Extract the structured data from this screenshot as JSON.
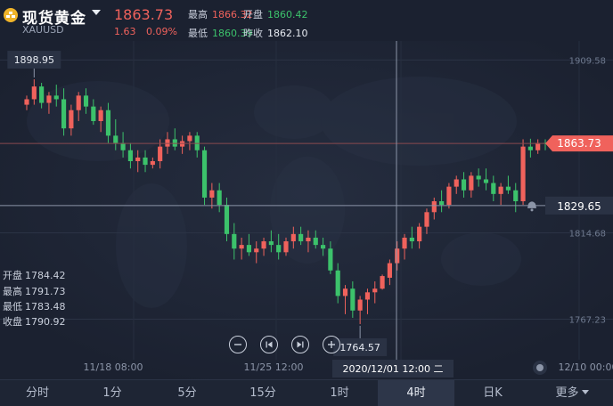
{
  "header": {
    "title": "现货黄金",
    "symbol": "XAUUSD",
    "price": "1863.73",
    "change": "1.63",
    "change_pct": "0.09%",
    "high_label": "最高",
    "high": "1866.32",
    "open_label": "开盘",
    "open": "1860.42",
    "low_label": "最低",
    "low": "1860.39",
    "prev_label": "昨收",
    "prev_close": "1862.10"
  },
  "chart": {
    "y_ticks": [
      "1909.58",
      "1814.68",
      "1767.23"
    ],
    "price_tag_current": "1863.73",
    "price_tag_cursor": "1829.65",
    "annot_high": "1898.95",
    "annot_low": "1764.57",
    "x_labels": [
      "11/18 08:00",
      "11/25 12:00",
      "12/10 00:00"
    ],
    "crosshair_label": "2020/12/01 12:00 二"
  },
  "ohlc": {
    "open_label": "开盘",
    "open": "1784.42",
    "high_label": "最高",
    "high": "1791.73",
    "low_label": "最低",
    "low": "1783.48",
    "close_label": "收盘",
    "close": "1790.92"
  },
  "tabs": [
    "分时",
    "1分",
    "5分",
    "15分",
    "1时",
    "4时",
    "日K",
    "更多"
  ],
  "active_tab": "4时",
  "colors": {
    "up": "#f0625c",
    "down": "#3cc26b",
    "bg": "#1b2130",
    "logo": "#f0b429"
  },
  "chart_data": {
    "type": "candlestick",
    "series": [
      {
        "values": [
          [
            1885,
            1890,
            1882,
            1888
          ],
          [
            1888,
            1898.95,
            1885,
            1895
          ],
          [
            1895,
            1897,
            1883,
            1886
          ],
          [
            1886,
            1892,
            1880,
            1890
          ],
          [
            1890,
            1896,
            1884,
            1888
          ],
          [
            1888,
            1894,
            1868,
            1872
          ],
          [
            1872,
            1885,
            1868,
            1882
          ],
          [
            1882,
            1892,
            1876,
            1890
          ],
          [
            1890,
            1894,
            1880,
            1884
          ],
          [
            1884,
            1888,
            1874,
            1876
          ],
          [
            1876,
            1884,
            1870,
            1882
          ],
          [
            1882,
            1886,
            1864,
            1868
          ],
          [
            1868,
            1877,
            1860,
            1864
          ],
          [
            1864,
            1870,
            1856,
            1860
          ],
          [
            1860,
            1864,
            1850,
            1854
          ],
          [
            1854,
            1860,
            1848,
            1856
          ],
          [
            1856,
            1860,
            1848,
            1852
          ],
          [
            1852,
            1856,
            1850,
            1854
          ],
          [
            1854,
            1866,
            1850,
            1862
          ],
          [
            1862,
            1870,
            1858,
            1866
          ],
          [
            1866,
            1872,
            1860,
            1862
          ],
          [
            1862,
            1868,
            1858,
            1865
          ],
          [
            1865,
            1870,
            1860,
            1868
          ],
          [
            1868,
            1870,
            1856,
            1860
          ],
          [
            1860,
            1862,
            1830,
            1834
          ],
          [
            1834,
            1842,
            1828,
            1838
          ],
          [
            1838,
            1842,
            1826,
            1830
          ],
          [
            1830,
            1834,
            1810,
            1814
          ],
          [
            1814,
            1820,
            1800,
            1806
          ],
          [
            1806,
            1812,
            1800,
            1808
          ],
          [
            1808,
            1814,
            1802,
            1804
          ],
          [
            1804,
            1810,
            1798,
            1806
          ],
          [
            1806,
            1812,
            1802,
            1810
          ],
          [
            1810,
            1816,
            1804,
            1808
          ],
          [
            1808,
            1814,
            1800,
            1804
          ],
          [
            1804,
            1812,
            1802,
            1810
          ],
          [
            1810,
            1818,
            1806,
            1814
          ],
          [
            1814,
            1818,
            1808,
            1810
          ],
          [
            1810,
            1816,
            1804,
            1812
          ],
          [
            1812,
            1816,
            1806,
            1808
          ],
          [
            1808,
            1812,
            1802,
            1806
          ],
          [
            1806,
            1810,
            1792,
            1794
          ],
          [
            1794,
            1798,
            1776,
            1780
          ],
          [
            1780,
            1786,
            1770,
            1784
          ],
          [
            1784,
            1788,
            1768,
            1772
          ],
          [
            1772,
            1780,
            1764.57,
            1778
          ],
          [
            1778,
            1784,
            1770,
            1782
          ],
          [
            1782,
            1788,
            1776,
            1784
          ],
          [
            1784,
            1791.73,
            1783.48,
            1790.92
          ],
          [
            1790,
            1800,
            1786,
            1798
          ],
          [
            1798,
            1810,
            1794,
            1806
          ],
          [
            1806,
            1814,
            1800,
            1812
          ],
          [
            1812,
            1818,
            1806,
            1810
          ],
          [
            1810,
            1820,
            1806,
            1818
          ],
          [
            1818,
            1828,
            1814,
            1826
          ],
          [
            1826,
            1834,
            1822,
            1832
          ],
          [
            1832,
            1838,
            1826,
            1830
          ],
          [
            1830,
            1842,
            1828,
            1840
          ],
          [
            1840,
            1846,
            1836,
            1844
          ],
          [
            1844,
            1848,
            1834,
            1838
          ],
          [
            1838,
            1848,
            1834,
            1846
          ],
          [
            1846,
            1850,
            1840,
            1844
          ],
          [
            1844,
            1850,
            1838,
            1842
          ],
          [
            1842,
            1846,
            1832,
            1836
          ],
          [
            1836,
            1842,
            1830,
            1840
          ],
          [
            1840,
            1846,
            1836,
            1838
          ],
          [
            1838,
            1842,
            1826,
            1832
          ],
          [
            1832,
            1866,
            1830,
            1862
          ],
          [
            1862,
            1866.32,
            1856,
            1860
          ],
          [
            1860,
            1866,
            1858,
            1864
          ],
          [
            1864,
            1866,
            1860,
            1863.73
          ]
        ]
      }
    ],
    "x": [
      "11/18 08:00",
      "11/25 12:00",
      "2020/12/01 12:00",
      "12/10 00:00"
    ],
    "ylim": [
      1745,
      1920
    ],
    "grid": true
  }
}
